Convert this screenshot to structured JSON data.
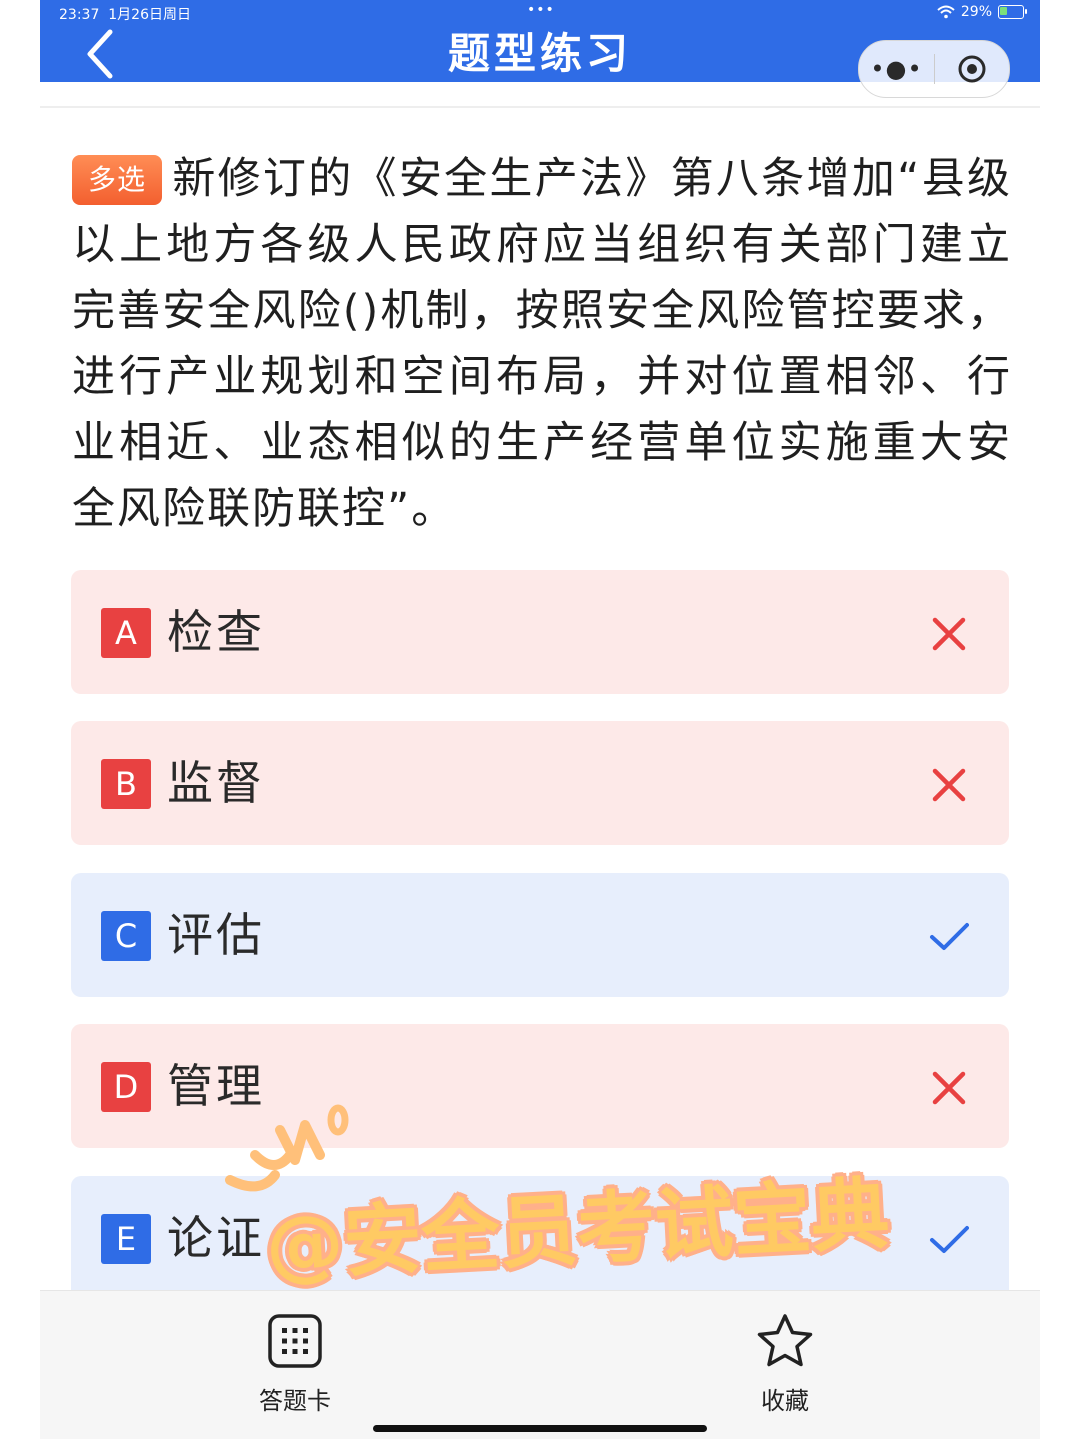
{
  "status_bar": {
    "time": "23:37",
    "date": "1月26日周日",
    "battery": "29%"
  },
  "header": {
    "title": "题型练习"
  },
  "question": {
    "type_badge": "多选",
    "text": "新修订的《安全生产法》第八条增加“县级以上地方各级人民政府应当组织有关部门建立完善安全风险()机制，按照安全风险管控要求，进行产业规划和空间布局，并对位置相邻、行业相近、业态相似的生产经营单位实施重大安全风险联防联控”。"
  },
  "options": [
    {
      "letter": "A",
      "text": "检查",
      "status": "wrong"
    },
    {
      "letter": "B",
      "text": "监督",
      "status": "wrong"
    },
    {
      "letter": "C",
      "text": "评估",
      "status": "correct"
    },
    {
      "letter": "D",
      "text": "管理",
      "status": "wrong"
    },
    {
      "letter": "E",
      "text": "论证",
      "status": "correct"
    }
  ],
  "watermark": "@安全员考试宝典",
  "bottom_bar": {
    "answer_card_label": "答题卡",
    "favorite_label": "收藏"
  },
  "colors": {
    "primary": "#2f6ce6",
    "wrong_bg": "#fde9e8",
    "correct_bg": "#e7eefc",
    "wrong": "#e84141",
    "badge": "#f56a37"
  }
}
